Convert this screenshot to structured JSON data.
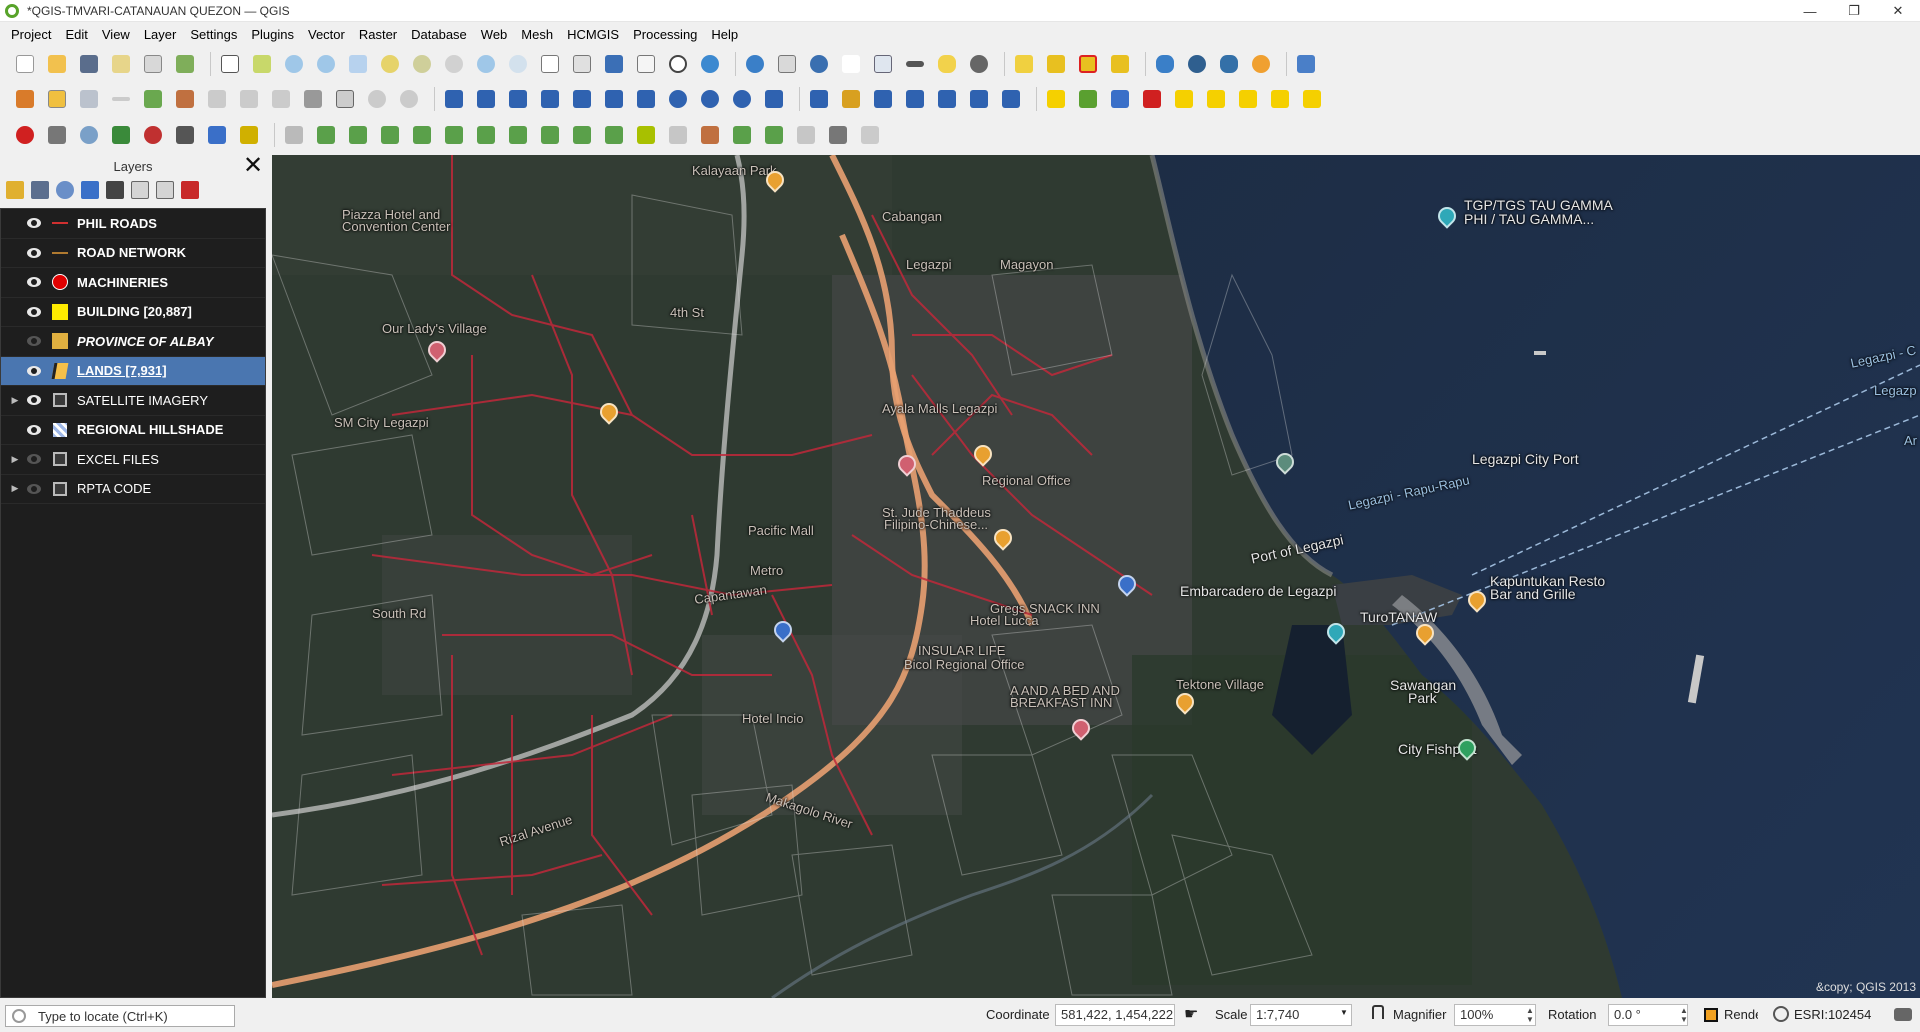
{
  "window": {
    "title": "*QGIS-TMVARI-CATANAUAN QUEZON — QGIS",
    "minimize": "—",
    "restore": "❐",
    "close": "✕"
  },
  "menu": [
    "Project",
    "Edit",
    "View",
    "Layer",
    "Settings",
    "Plugins",
    "Vector",
    "Raster",
    "Database",
    "Web",
    "Mesh",
    "HCMGIS",
    "Processing",
    "Help"
  ],
  "layers_panel": {
    "title": "Layers",
    "close_glyph": "✕",
    "items": [
      {
        "name": "PHIL ROADS",
        "symbol": "line",
        "color": "#d03030",
        "visible": true,
        "expandable": false,
        "style": "bold"
      },
      {
        "name": "ROAD NETWORK",
        "symbol": "line",
        "color": "#b07a30",
        "visible": true,
        "expandable": false,
        "style": "bold"
      },
      {
        "name": "MACHINERIES",
        "symbol": "circle",
        "color": "#e00000",
        "visible": true,
        "expandable": false,
        "style": "bold"
      },
      {
        "name": "BUILDING [20,887]",
        "symbol": "fill",
        "color": "#ffeb00",
        "visible": true,
        "expandable": false,
        "style": "bold"
      },
      {
        "name": "PROVINCE OF ALBAY",
        "symbol": "fill",
        "color": "#e0b040",
        "visible": false,
        "expandable": false,
        "style": "italic"
      },
      {
        "name": "LANDS [7,931]",
        "symbol": "edit",
        "color": "#f5c04a",
        "visible": true,
        "expandable": false,
        "style": "underline",
        "selected": true
      },
      {
        "name": "SATELLITE IMAGERY",
        "symbol": "group",
        "color": "#bbbbbb",
        "visible": true,
        "expandable": true,
        "style": "normal"
      },
      {
        "name": "REGIONAL HILLSHADE",
        "symbol": "raster",
        "color": "#9fb8e8",
        "visible": true,
        "expandable": false,
        "style": "bold"
      },
      {
        "name": "EXCEL FILES",
        "symbol": "group",
        "color": "#bbbbbb",
        "visible": false,
        "expandable": true,
        "style": "normal"
      },
      {
        "name": "RPTA CODE",
        "symbol": "group",
        "color": "#bbbbbb",
        "visible": false,
        "expandable": true,
        "style": "normal"
      }
    ]
  },
  "map": {
    "labels": [
      {
        "text": "TGP/TGS TAU GAMMA",
        "cls": ""
      },
      {
        "text": "PHI / TAU GAMMA...",
        "cls": ""
      },
      {
        "text": "Legazpi City Port",
        "cls": ""
      },
      {
        "text": "Legazpi - Rapu-Rapu",
        "cls": "water"
      },
      {
        "text": "Port of Legazpi",
        "cls": ""
      },
      {
        "text": "Embarcadero de Legazpi",
        "cls": ""
      },
      {
        "text": "Kapuntukan Resto",
        "cls": ""
      },
      {
        "text": "Bar and Grille",
        "cls": ""
      },
      {
        "text": "TuroTANAW",
        "cls": ""
      },
      {
        "text": "Sawangan",
        "cls": ""
      },
      {
        "text": "Park",
        "cls": ""
      },
      {
        "text": "City Fishport",
        "cls": ""
      },
      {
        "text": "Kalayaan Park",
        "cls": "dim"
      },
      {
        "text": "Piazza Hotel and",
        "cls": "dim"
      },
      {
        "text": "Convention Center",
        "cls": "dim"
      },
      {
        "text": "Our Lady's Village",
        "cls": "dim"
      },
      {
        "text": "4th St",
        "cls": "dim"
      },
      {
        "text": "Cabangan",
        "cls": "dim"
      },
      {
        "text": "Legazpi",
        "cls": "dim"
      },
      {
        "text": "Magayon",
        "cls": "dim"
      },
      {
        "text": "Ayala Malls Legazpi",
        "cls": "dim"
      },
      {
        "text": "SM City Legazpi",
        "cls": "dim"
      },
      {
        "text": "Pacific Mall",
        "cls": "dim"
      },
      {
        "text": "Metro",
        "cls": "dim"
      },
      {
        "text": "Regional Office",
        "cls": "dim"
      },
      {
        "text": "St. Jude Thaddeus",
        "cls": "dim"
      },
      {
        "text": "Filipino-Chinese...",
        "cls": "dim"
      },
      {
        "text": "Gregs SNACK INN",
        "cls": "dim"
      },
      {
        "text": "Hotel Lucca",
        "cls": "dim"
      },
      {
        "text": "INSULAR LIFE",
        "cls": "dim"
      },
      {
        "text": "Bicol Regional Office",
        "cls": "dim"
      },
      {
        "text": "A AND A BED AND",
        "cls": "dim"
      },
      {
        "text": "BREAKFAST INN",
        "cls": "dim"
      },
      {
        "text": "Tektone Village",
        "cls": "dim"
      },
      {
        "text": "Hotel Incio",
        "cls": "dim"
      },
      {
        "text": "Rizal Avenue",
        "cls": "dim"
      },
      {
        "text": "Makagolo River",
        "cls": "dim"
      },
      {
        "text": "South Rd",
        "cls": "dim"
      },
      {
        "text": "Capantawan",
        "cls": "dim"
      },
      {
        "text": "Legazpi - C",
        "cls": "water"
      },
      {
        "text": "Legazp",
        "cls": "water"
      },
      {
        "text": "Ar",
        "cls": "water"
      }
    ],
    "copyright": "&copy; QGIS 2013"
  },
  "statusbar": {
    "locator_placeholder": "Type to locate (Ctrl+K)",
    "coordinate_label": "Coordinate",
    "coordinate_value": "581,422, 1,454,222",
    "scale_label": "Scale",
    "scale_value": "1:7,740",
    "magnifier_label": "Magnifier",
    "magnifier_value": "100%",
    "rotation_label": "Rotation",
    "rotation_value": "0.0 °",
    "render_label": "Render",
    "crs": "ESRI:102454"
  }
}
